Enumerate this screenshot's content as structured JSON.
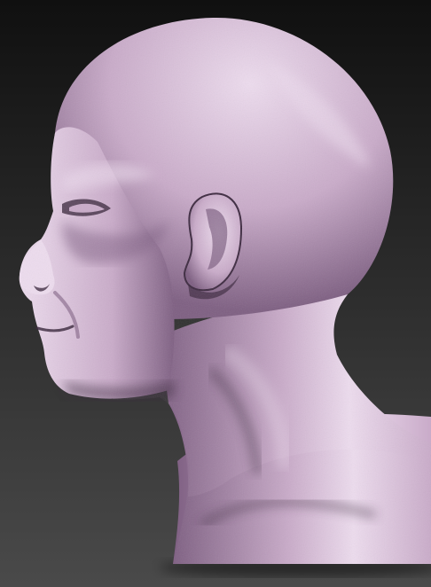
{
  "scene": {
    "subject": "",
    "colors": {
      "background_top": "#101010",
      "background_bottom": "#4a4a4a",
      "skin_light": "#eddcee",
      "skin_mid": "#c9abc9",
      "skin_shadow": "#7e5f82",
      "skin_deep": "#3d2a40"
    }
  }
}
